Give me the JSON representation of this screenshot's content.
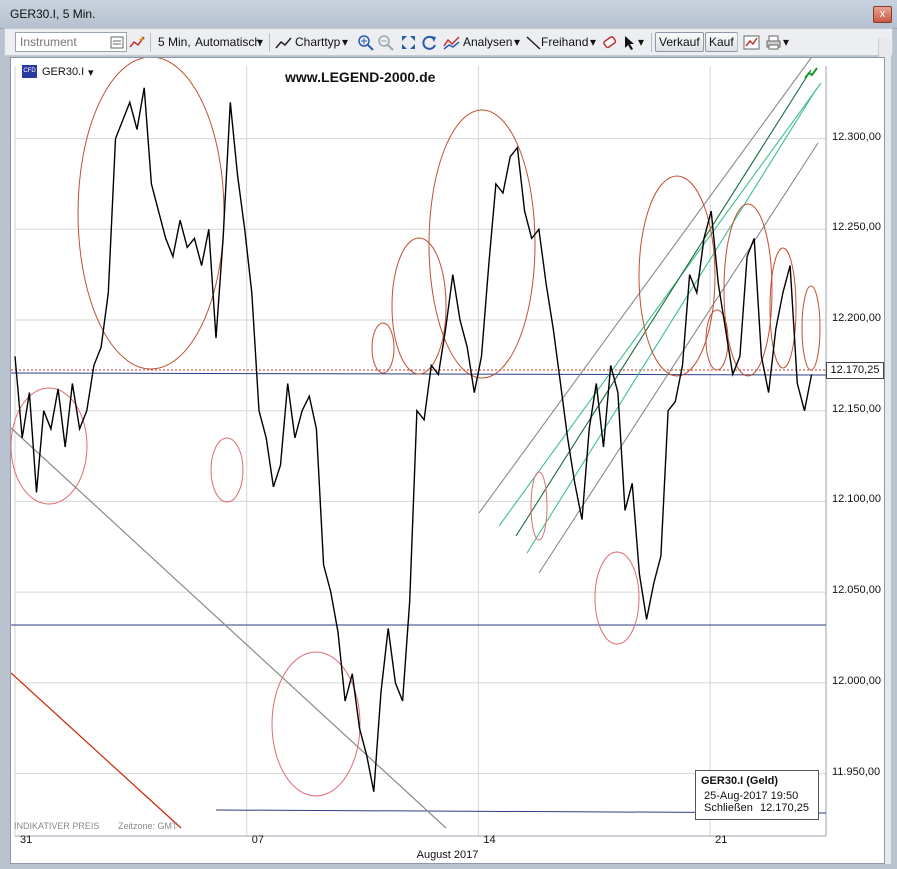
{
  "window": {
    "title": "GER30.I, 5 Min.",
    "close_label": "x"
  },
  "toolbar": {
    "instrument_placeholder": "Instrument",
    "interval_label": "5 Min,",
    "interval_mode": "Automatisch",
    "charttype_label": "Charttyp",
    "analysen_label": "Analysen",
    "freihand_label": "Freihand",
    "verkauf_label": "Verkauf",
    "kauf_label": "Kauf"
  },
  "chart_header": {
    "instrument": "GER30.I",
    "website": "www.LEGEND-2000.de"
  },
  "footer": {
    "indicative": "INDIKATIVER PREIS",
    "timezone": "Zeitzone: GMT",
    "month_label": "August 2017"
  },
  "current_price": "12.170,25",
  "infobox": {
    "title": "GER30.I (Geld)",
    "datetime": "25-Aug-2017 19:50",
    "close_label": "Schließen",
    "close_value": "12.170,25"
  },
  "colors": {
    "price_line": "#000000",
    "ellipse": "#c0502e",
    "ellipse_light": "#e06a72",
    "support": "#2b3d86",
    "channel_dark": "#1a6a3a",
    "channel_light": "#3fbf8f",
    "trend_gray": "#8a8a8a",
    "trend_red": "#cc2200"
  },
  "chart_data": {
    "type": "line",
    "title": "GER30.I, 5 Min.",
    "x_tick_labels": [
      "31",
      "07",
      "14",
      "21"
    ],
    "y_tick_labels": [
      "12.300,00",
      "12.250,00",
      "12.200,00",
      "12.150,00",
      "12.100,00",
      "12.050,00",
      "12.000,00",
      "11.950,00"
    ],
    "ylim": [
      11920,
      12340
    ],
    "grid": true,
    "x_unit": "day",
    "x": [
      0.0,
      0.3,
      0.6,
      0.9,
      1.2,
      1.5,
      1.8,
      2.1,
      2.4,
      2.7,
      3.0,
      3.3,
      3.6,
      3.9,
      4.2,
      4.5,
      4.8,
      5.1,
      5.4,
      5.7,
      6.0,
      6.3,
      6.6,
      6.9,
      7.2,
      7.5,
      7.8,
      8.1,
      8.4,
      8.7,
      9.0,
      9.3,
      9.6,
      9.9,
      10.2,
      10.5,
      10.8,
      11.1,
      11.4,
      11.7,
      12.0,
      12.3,
      12.6,
      12.9,
      13.2,
      13.5,
      13.8,
      14.1,
      14.4,
      14.7,
      15.0,
      15.3,
      15.6,
      15.9,
      16.2,
      16.5,
      16.8,
      17.1,
      17.4,
      17.7,
      18.0,
      18.3,
      18.6,
      18.9,
      19.2,
      19.5,
      19.8,
      20.1,
      20.4,
      20.7,
      21.0,
      21.3,
      21.6,
      21.9,
      22.2,
      22.5,
      22.8,
      23.1,
      23.4,
      23.7,
      24.0,
      24.3,
      24.6,
      24.9,
      25.2,
      25.5,
      25.8,
      26.1,
      26.4,
      26.7,
      27.0,
      27.3,
      27.6,
      27.9,
      28.2,
      28.5,
      28.8,
      29.1,
      29.4,
      29.7,
      30.0,
      30.3,
      30.6,
      30.9,
      31.2,
      31.5,
      31.8,
      32.1,
      32.4,
      32.7,
      33.0,
      33.3,
      33.6,
      33.9
    ],
    "values": [
      12180,
      12135,
      12160,
      12105,
      12150,
      12140,
      12162,
      12130,
      12165,
      12140,
      12150,
      12175,
      12185,
      12215,
      12300,
      12310,
      12320,
      12305,
      12328,
      12275,
      12260,
      12245,
      12235,
      12255,
      12240,
      12245,
      12230,
      12250,
      12190,
      12245,
      12320,
      12280,
      12250,
      12215,
      12150,
      12135,
      12108,
      12120,
      12165,
      12135,
      12150,
      12158,
      12140,
      12065,
      12050,
      12028,
      11990,
      12005,
      11975,
      11960,
      11940,
      11995,
      12030,
      12000,
      11990,
      12045,
      12150,
      12145,
      12175,
      12170,
      12195,
      12225,
      12200,
      12185,
      12160,
      12180,
      12230,
      12275,
      12270,
      12290,
      12295,
      12260,
      12245,
      12250,
      12220,
      12195,
      12165,
      12135,
      12110,
      12090,
      12140,
      12165,
      12130,
      12175,
      12160,
      12095,
      12110,
      12060,
      12035,
      12055,
      12070,
      12150,
      12155,
      12175,
      12225,
      12215,
      12245,
      12260,
      12220,
      12195,
      12170,
      12180,
      12235,
      12245,
      12180,
      12160,
      12195,
      12215,
      12230,
      12165,
      12150,
      12170
    ]
  }
}
